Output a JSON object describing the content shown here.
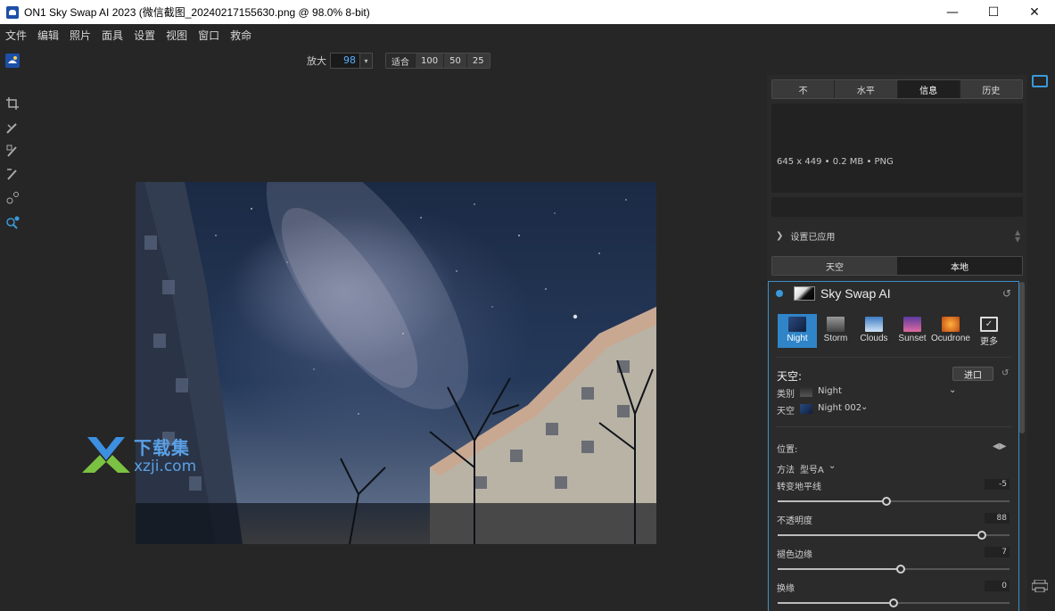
{
  "window": {
    "title": "ON1 Sky Swap AI 2023 (微信截图_20240217155630.png @ 98.0% 8-bit)",
    "minimize": "—",
    "maximize": "☐",
    "close": "✕"
  },
  "menu": [
    "文件",
    "编辑",
    "照片",
    "面具",
    "设置",
    "视图",
    "窗口",
    "救命"
  ],
  "zoom": {
    "label": "放大",
    "value": "98",
    "presets": [
      "适合",
      "100",
      "50",
      "25"
    ]
  },
  "watermark": {
    "cn": "下载集",
    "en": "xzji.com"
  },
  "info_tabs": [
    "不",
    "水平",
    "信息",
    "历史"
  ],
  "active_info_tab": 2,
  "file_info": "645 x 449 • 0.2 MB • PNG",
  "settings_applied": "设置已应用",
  "panel_tabs": [
    "天空",
    "本地"
  ],
  "active_panel_tab": 1,
  "module": {
    "title": "Sky Swap AI",
    "presets": [
      {
        "label": "Night",
        "icon": "night-preset-icon",
        "color": "#1f3b6e"
      },
      {
        "label": "Storm",
        "icon": "storm-preset-icon",
        "color": "#777777"
      },
      {
        "label": "Clouds",
        "icon": "clouds-preset-icon",
        "color": "#4a8fd0"
      },
      {
        "label": "Sunset",
        "icon": "sunset-preset-icon",
        "color": "#9a4a9e"
      },
      {
        "label": "Ocudrone",
        "icon": "ocudrone-preset-icon",
        "color": "#e07a20"
      },
      {
        "label": "更多",
        "icon": "more-preset-icon",
        "color": "#2b2b2b"
      }
    ],
    "active_preset": 0,
    "sky_heading": "天空:",
    "import_button": "进口",
    "category_label": "类别",
    "category_value": "Night",
    "sky_label": "天空",
    "sky_value": "Night 002",
    "position_heading": "位置:",
    "method_label": "方法",
    "method_value": "型号A",
    "sliders": [
      {
        "label": "转变地平线",
        "value": "-5",
        "fraction": 0.47
      },
      {
        "label": "不透明度",
        "value": "88",
        "fraction": 0.88
      },
      {
        "label": "褪色边缘",
        "value": "7",
        "fraction": 0.53
      },
      {
        "label": "换缘",
        "value": "0",
        "fraction": 0.5
      }
    ]
  },
  "colors": {
    "accent": "#2f85c8",
    "panel_bg": "#2a2a2a",
    "app_bg": "#262626"
  }
}
